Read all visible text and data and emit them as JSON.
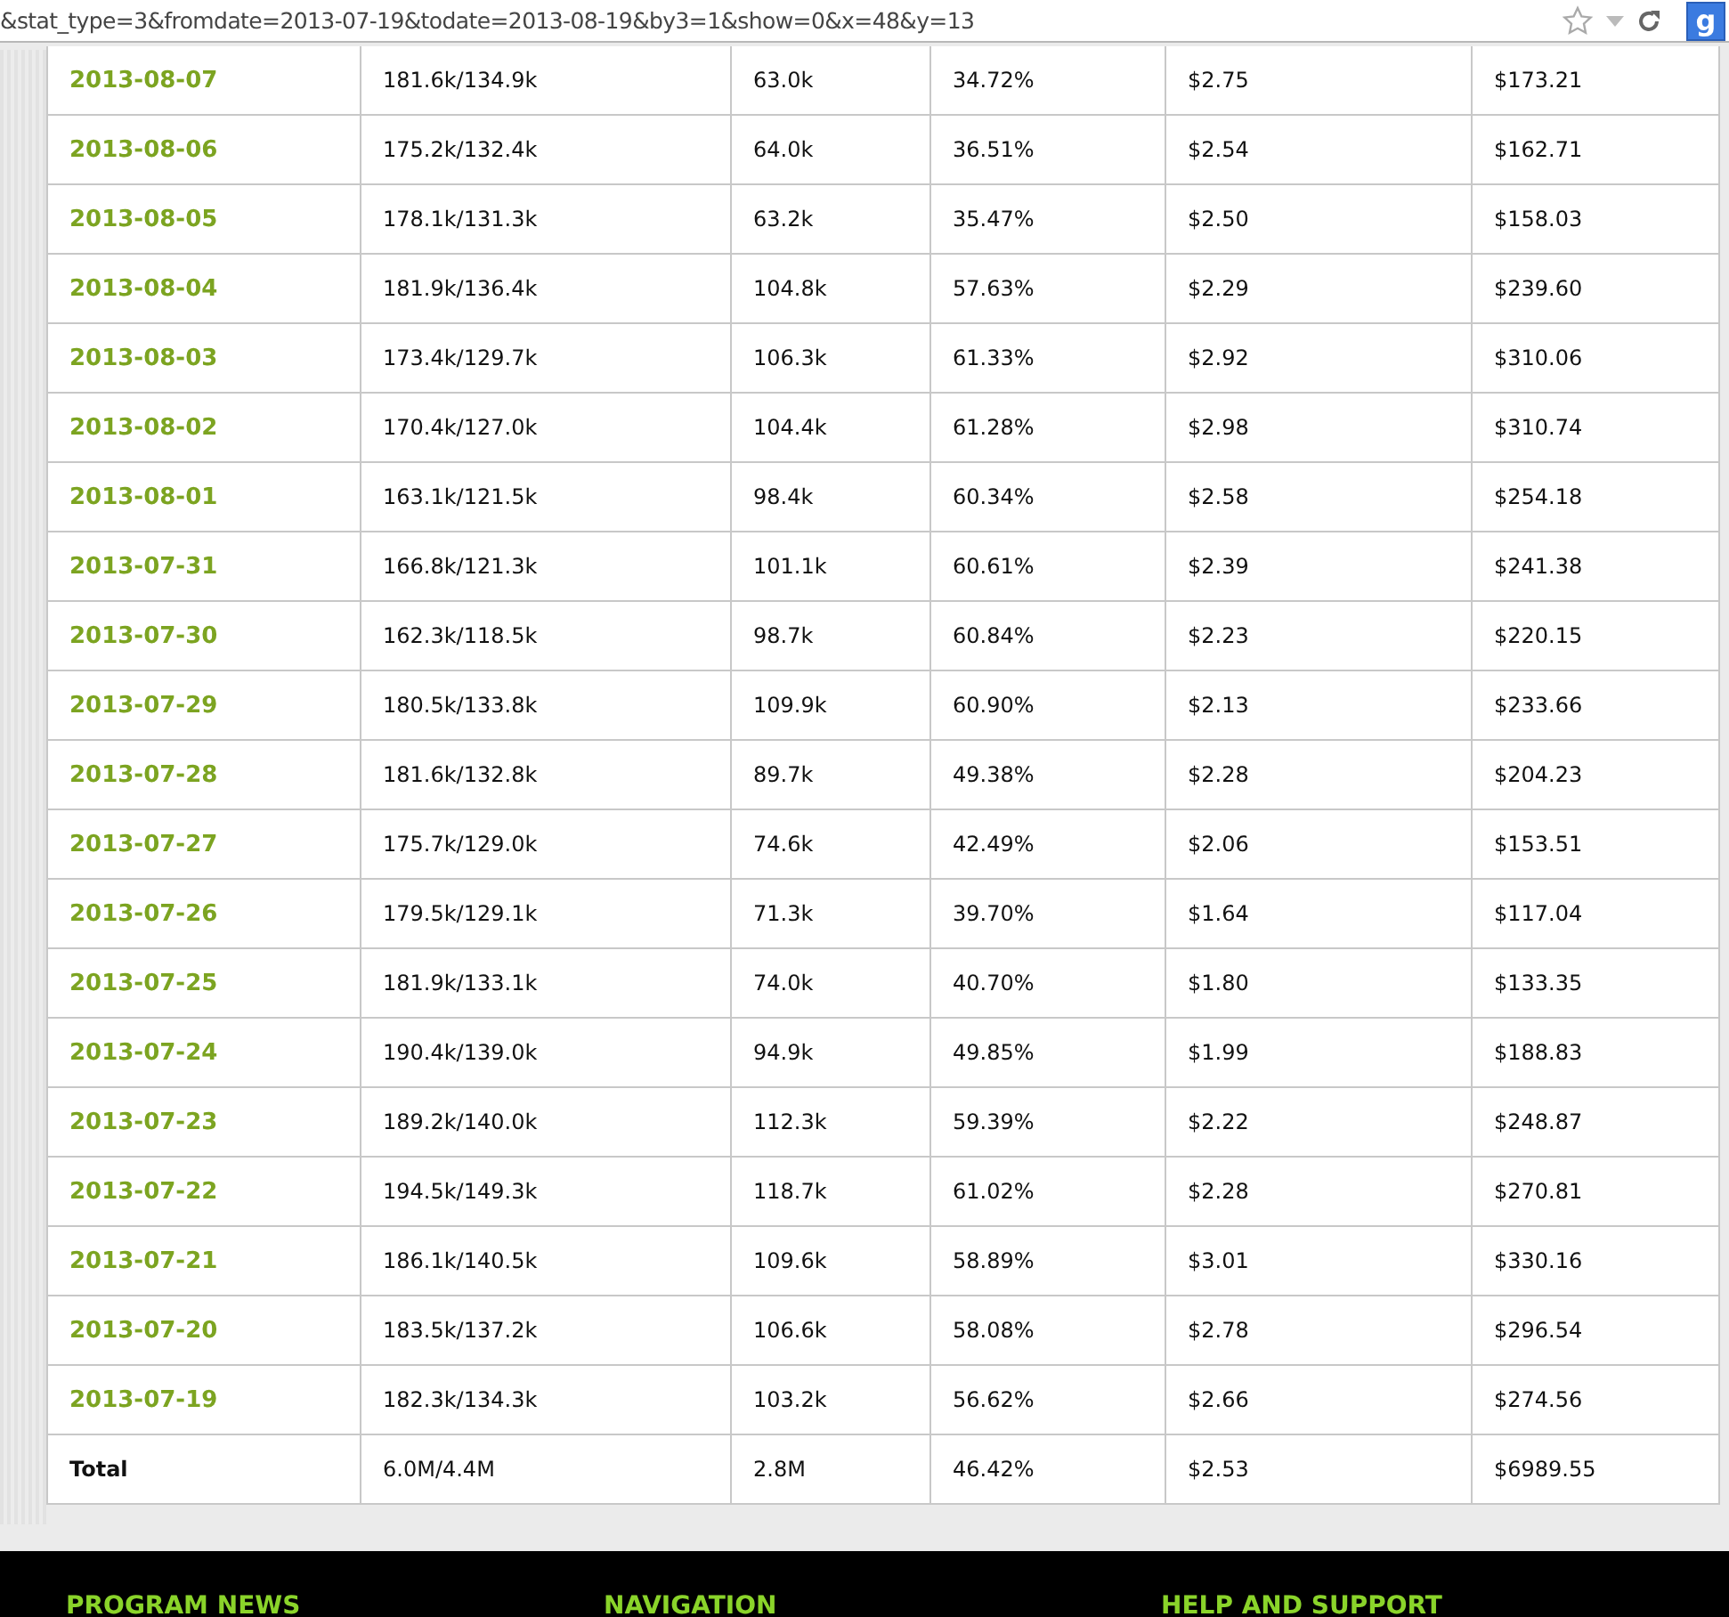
{
  "address_bar": {
    "url": "&stat_type=3&fromdate=2013-07-19&todate=2013-08-19&by3=1&show=0&x=48&y=13",
    "search_button": "g"
  },
  "table": {
    "rows": [
      [
        "2013-08-07",
        "181.6k/134.9k",
        "63.0k",
        "34.72%",
        "$2.75",
        "$173.21"
      ],
      [
        "2013-08-06",
        "175.2k/132.4k",
        "64.0k",
        "36.51%",
        "$2.54",
        "$162.71"
      ],
      [
        "2013-08-05",
        "178.1k/131.3k",
        "63.2k",
        "35.47%",
        "$2.50",
        "$158.03"
      ],
      [
        "2013-08-04",
        "181.9k/136.4k",
        "104.8k",
        "57.63%",
        "$2.29",
        "$239.60"
      ],
      [
        "2013-08-03",
        "173.4k/129.7k",
        "106.3k",
        "61.33%",
        "$2.92",
        "$310.06"
      ],
      [
        "2013-08-02",
        "170.4k/127.0k",
        "104.4k",
        "61.28%",
        "$2.98",
        "$310.74"
      ],
      [
        "2013-08-01",
        "163.1k/121.5k",
        "98.4k",
        "60.34%",
        "$2.58",
        "$254.18"
      ],
      [
        "2013-07-31",
        "166.8k/121.3k",
        "101.1k",
        "60.61%",
        "$2.39",
        "$241.38"
      ],
      [
        "2013-07-30",
        "162.3k/118.5k",
        "98.7k",
        "60.84%",
        "$2.23",
        "$220.15"
      ],
      [
        "2013-07-29",
        "180.5k/133.8k",
        "109.9k",
        "60.90%",
        "$2.13",
        "$233.66"
      ],
      [
        "2013-07-28",
        "181.6k/132.8k",
        "89.7k",
        "49.38%",
        "$2.28",
        "$204.23"
      ],
      [
        "2013-07-27",
        "175.7k/129.0k",
        "74.6k",
        "42.49%",
        "$2.06",
        "$153.51"
      ],
      [
        "2013-07-26",
        "179.5k/129.1k",
        "71.3k",
        "39.70%",
        "$1.64",
        "$117.04"
      ],
      [
        "2013-07-25",
        "181.9k/133.1k",
        "74.0k",
        "40.70%",
        "$1.80",
        "$133.35"
      ],
      [
        "2013-07-24",
        "190.4k/139.0k",
        "94.9k",
        "49.85%",
        "$1.99",
        "$188.83"
      ],
      [
        "2013-07-23",
        "189.2k/140.0k",
        "112.3k",
        "59.39%",
        "$2.22",
        "$248.87"
      ],
      [
        "2013-07-22",
        "194.5k/149.3k",
        "118.7k",
        "61.02%",
        "$2.28",
        "$270.81"
      ],
      [
        "2013-07-21",
        "186.1k/140.5k",
        "109.6k",
        "58.89%",
        "$3.01",
        "$330.16"
      ],
      [
        "2013-07-20",
        "183.5k/137.2k",
        "106.6k",
        "58.08%",
        "$2.78",
        "$296.54"
      ],
      [
        "2013-07-19",
        "182.3k/134.3k",
        "103.2k",
        "56.62%",
        "$2.66",
        "$274.56"
      ]
    ],
    "total": [
      "Total",
      "6.0M/4.4M",
      "2.8M",
      "46.42%",
      "$2.53",
      "$6989.55"
    ]
  },
  "footer": {
    "headings": [
      "PROGRAM NEWS",
      "NAVIGATION",
      "HELP AND SUPPORT"
    ]
  }
}
